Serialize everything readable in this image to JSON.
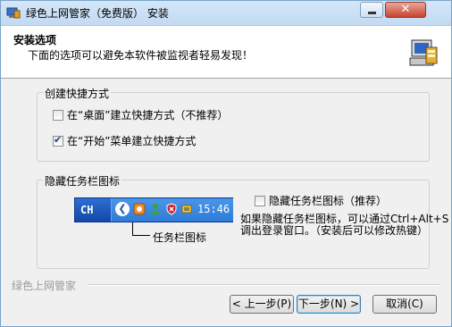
{
  "window": {
    "title": "绿色上网管家（免费版）  安装",
    "close_glyph": "✕"
  },
  "header": {
    "title": "安装选项",
    "subtitle": "下面的选项可以避免本软件被监视者轻易发现！"
  },
  "shortcut_group": {
    "legend": "创建快捷方式",
    "options": [
      {
        "label": "在“桌面”建立快捷方式（不推荐）",
        "checked": false
      },
      {
        "label": "在“开始”菜单建立快捷方式",
        "checked": true
      }
    ]
  },
  "tray_group": {
    "legend": "隐藏任务栏图标",
    "checkbox_label": "隐藏任务栏图标（推荐）",
    "checkbox_checked": false,
    "taskbar": {
      "lang": "CH",
      "clock": "15:46",
      "tray_icons": [
        "chevron-left-icon",
        "orange-app-icon",
        "user-icon",
        "shield-icon",
        "network-icon"
      ]
    },
    "callout": "任务栏图标",
    "description": "如果隐藏任务栏图标，可以通过Ctrl+Alt+S调出登录窗口。（安装后可以修改热键）"
  },
  "footer": {
    "brand": "绿色上网管家",
    "buttons": {
      "back": "< 上一步(P)",
      "next": "下一步(N) >",
      "cancel": "取消(C)"
    }
  },
  "colors": {
    "titlebar": "#c9def4",
    "taskbar": "#1f5bc0",
    "header_bg": "#ffffff",
    "dialog_bg": "#f0f0f0"
  }
}
